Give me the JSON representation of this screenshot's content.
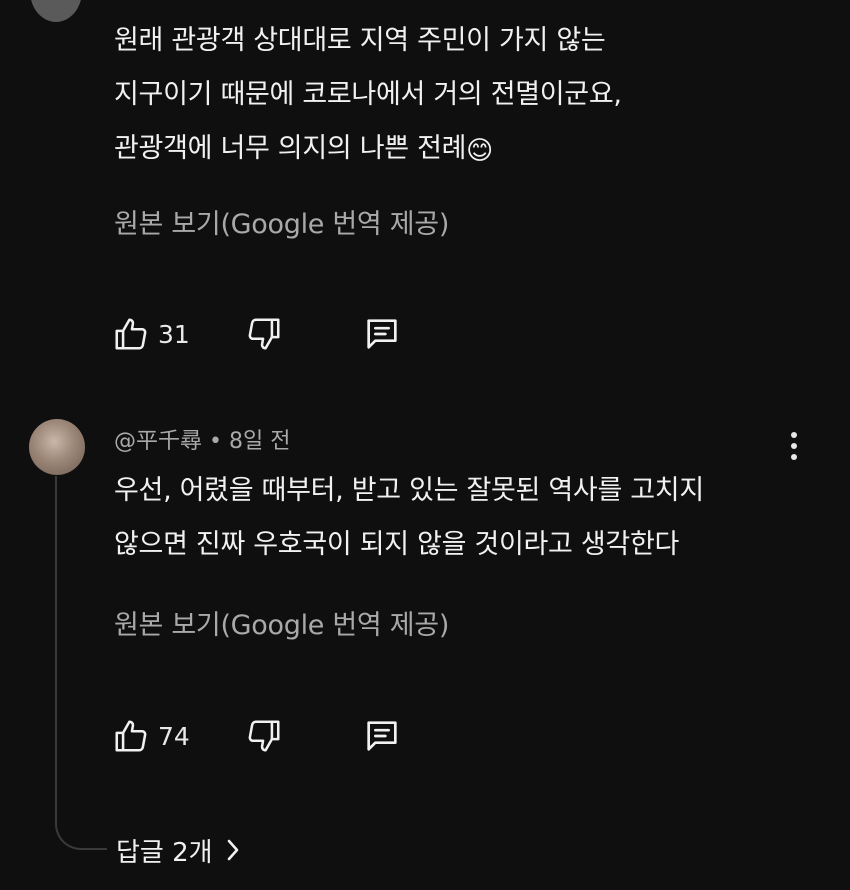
{
  "comment_1": {
    "lines": [
      "원래 관광객 상대대로 지역 주민이 가지 않는",
      "지구이기 때문에 코로나에서 거의 전멸이군요,",
      "관광객에 너무 의지의 나쁜 전례"
    ],
    "emoji": "😊",
    "see_original": "원본 보기(Google 번역 제공)",
    "like_count": "31"
  },
  "comment_2": {
    "author": "@平千尋",
    "separator": "•",
    "time": "8일 전",
    "lines": [
      "우선, 어렸을 때부터, 받고 있는 잘못된 역사를 고치지",
      "않으면 진짜 우호국이 되지 않을 것이라고 생각한다"
    ],
    "see_original": "원본 보기(Google 번역 제공)",
    "like_count": "74",
    "replies_label": "답글 2개"
  },
  "icons": {
    "like": "thumbs-up-icon",
    "dislike": "thumbs-down-icon",
    "reply": "comment-icon",
    "more": "more-vertical-icon",
    "chevron": "chevron-right-icon"
  },
  "colors": {
    "background": "#0f0f0f",
    "text_primary": "#f1f1f1",
    "text_secondary": "#a9a9a9",
    "thread_line": "#3a3a3a"
  }
}
